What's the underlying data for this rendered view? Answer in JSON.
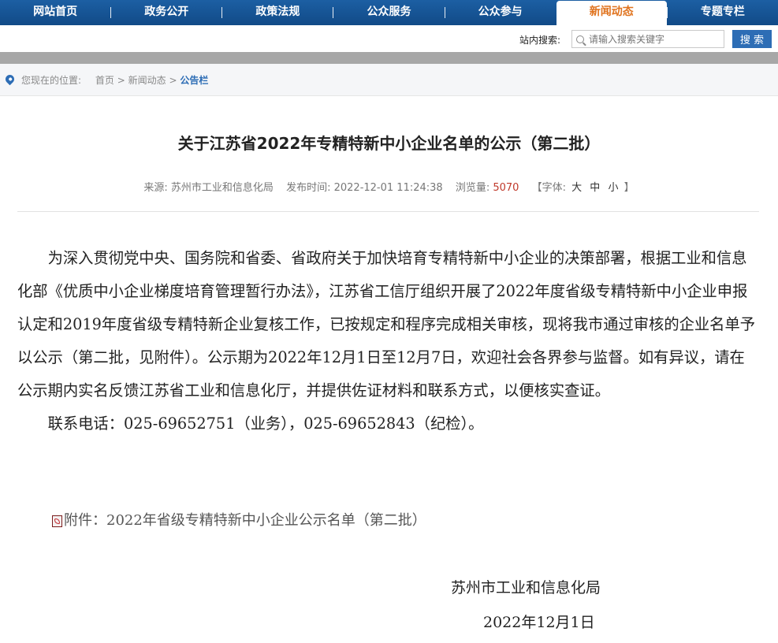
{
  "nav": {
    "items": [
      {
        "label": "网站首页",
        "active": false
      },
      {
        "label": "政务公开",
        "active": false
      },
      {
        "label": "政策法规",
        "active": false
      },
      {
        "label": "公众服务",
        "active": false
      },
      {
        "label": "公众参与",
        "active": false
      },
      {
        "label": "新闻动态",
        "active": true
      },
      {
        "label": "专题专栏",
        "active": false
      }
    ]
  },
  "search": {
    "label": "站内搜索:",
    "placeholder": "请输入搜索关键字",
    "button": "搜 索"
  },
  "breadcrumb": {
    "prefix": "您现在的位置:",
    "home": "首页",
    "sep1": ">",
    "section": "新闻动态",
    "sep2": ">",
    "current": "公告栏"
  },
  "article": {
    "title": "关于江苏省2022年专精特新中小企业名单的公示（第二批）",
    "meta": {
      "source_label": "来源:",
      "source": "苏州市工业和信息化局",
      "time_label": "发布时间:",
      "time": "2022-12-01 11:24:38",
      "views_label": "浏览量:",
      "views": "5070",
      "font_open": "【字体:",
      "font_large": "大",
      "font_medium": "中",
      "font_small": "小",
      "font_close": "】"
    },
    "paragraph1": "为深入贯彻党中央、国务院和省委、省政府关于加快培育专精特新中小企业的决策部署，根据工业和信息化部《优质中小企业梯度培育管理暂行办法》，江苏省工信厅组织开展了2022年度省级专精特新中小企业申报认定和2019年度省级专精特新企业复核工作，已按规定和程序完成相关审核，现将我市通过审核的企业名单予以公示（第二批，见附件）。公示期为2022年12月1日至12月7日，欢迎社会各界参与监督。如有异议，请在公示期内实名反馈江苏省工业和信息化厅，并提供佐证材料和联系方式，以便核实查证。",
    "paragraph2": "联系电话：025-69652751（业务），025-69652843（纪检）。",
    "attachment_label": "附件：",
    "attachment_name": "2022年省级专精特新中小企业公示名单（第二批）",
    "signature_org": "苏州市工业和信息化局",
    "signature_date": "2022年12月1日"
  },
  "colors": {
    "nav_bg": "#1c5fa3",
    "nav_active_text": "#e0731e",
    "accent": "#2d6db5",
    "views": "#c0392b"
  }
}
